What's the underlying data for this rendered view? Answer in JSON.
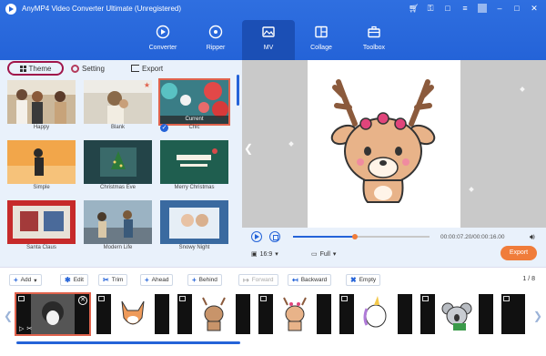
{
  "app": {
    "title": "AnyMP4 Video Converter Ultimate (Unregistered)"
  },
  "window_icons": [
    "cart-icon",
    "key-icon",
    "chat-icon",
    "menu-icon",
    "minimize-icon",
    "maximize-icon",
    "close-icon"
  ],
  "nav": {
    "tabs": [
      {
        "label": "Converter",
        "icon": "converter-icon"
      },
      {
        "label": "Ripper",
        "icon": "ripper-icon"
      },
      {
        "label": "MV",
        "icon": "mv-icon",
        "active": true
      },
      {
        "label": "Collage",
        "icon": "collage-icon"
      },
      {
        "label": "Toolbox",
        "icon": "toolbox-icon"
      }
    ]
  },
  "left_tabs": {
    "theme": "Theme",
    "setting": "Setting",
    "export": "Export"
  },
  "themes": [
    {
      "label": "Happy"
    },
    {
      "label": "Blank"
    },
    {
      "label": "Chic",
      "selected": true,
      "badge": "Current"
    },
    {
      "label": "Simple"
    },
    {
      "label": "Christmas Eve"
    },
    {
      "label": "Merry Christmas"
    },
    {
      "label": "Santa Claus"
    },
    {
      "label": "Modern Life"
    },
    {
      "label": "Snowy Night"
    }
  ],
  "player": {
    "time": "00:00:07.20/00:00:16.00",
    "progress": 0.45,
    "aspect": "16:9",
    "view": "Full",
    "export_label": "Export"
  },
  "toolbar": {
    "add": "Add",
    "edit": "Edit",
    "trim": "Trim",
    "ahead": "Ahead",
    "behind": "Behind",
    "forward": "Forward",
    "backward": "Backward",
    "empty": "Empty",
    "page": "1 / 8"
  },
  "colors": {
    "header": "#2463d8",
    "accent": "#f07c3a",
    "selection": "#e0634d"
  }
}
